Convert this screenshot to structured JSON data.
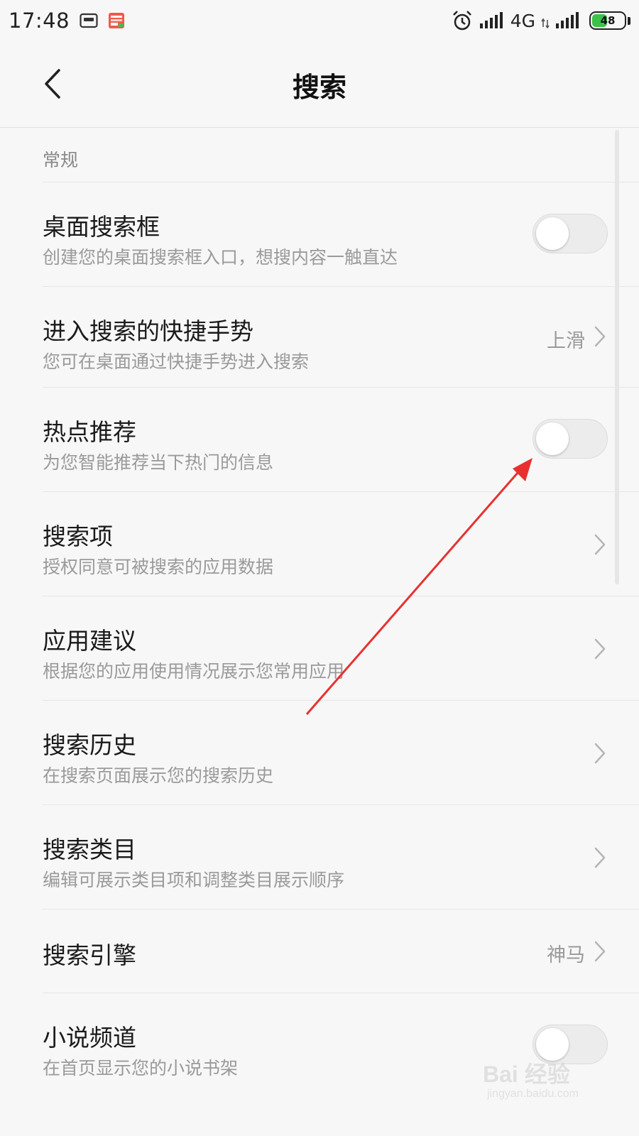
{
  "status_bar": {
    "time": "17:48",
    "network": "4G",
    "battery": "48",
    "battery_level": 0.48,
    "icons": [
      "screen-recorder-icon",
      "toutiao-app-icon",
      "alarm-icon",
      "signal-icon",
      "signal-icon-2"
    ]
  },
  "header": {
    "title": "搜索",
    "back_icon": "chevron-left-icon"
  },
  "section": {
    "label": "常规"
  },
  "rows": [
    {
      "title": "桌面搜索框",
      "subtitle": "创建您的桌面搜索框入口，想搜内容一触直达",
      "control": "toggle",
      "on": false
    },
    {
      "title": "进入搜索的快捷手势",
      "subtitle": "您可在桌面通过快捷手势进入搜索",
      "control": "value-chevron",
      "value": "上滑"
    },
    {
      "title": "热点推荐",
      "subtitle": "为您智能推荐当下热门的信息",
      "control": "toggle",
      "on": false
    },
    {
      "title": "搜索项",
      "subtitle": "授权同意可被搜索的应用数据",
      "control": "chevron"
    },
    {
      "title": "应用建议",
      "subtitle": "根据您的应用使用情况展示您常用应用",
      "control": "chevron"
    },
    {
      "title": "搜索历史",
      "subtitle": "在搜索页面展示您的搜索历史",
      "control": "chevron"
    },
    {
      "title": "搜索类目",
      "subtitle": "编辑可展示类目项和调整类目展示顺序",
      "control": "chevron"
    },
    {
      "title": "搜索引擎",
      "control": "value-chevron",
      "value": "神马"
    },
    {
      "title": "小说频道",
      "subtitle": "在首页显示您的小说书架",
      "control": "toggle",
      "on": false
    }
  ],
  "annotation": {
    "color": "#e8312f"
  },
  "watermark": {
    "brand": "Bai 经验",
    "site": "jingyan.baidu.com"
  }
}
